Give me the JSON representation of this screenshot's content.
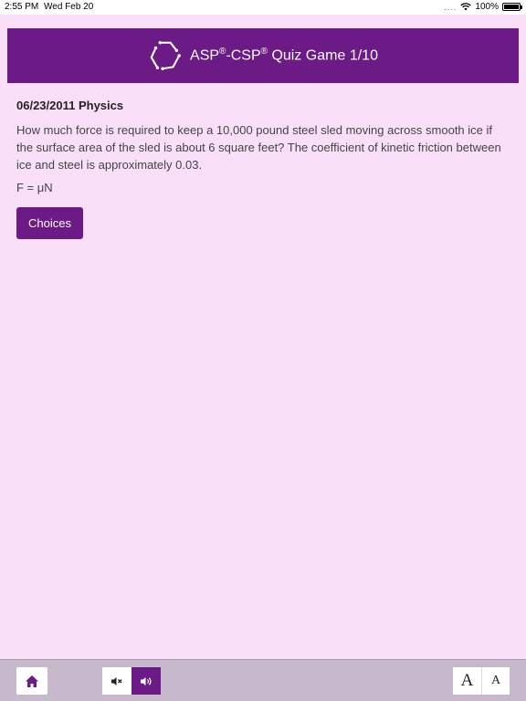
{
  "status_bar": {
    "time": "2:55 PM",
    "date": "Wed Feb 20",
    "battery": "100%"
  },
  "header": {
    "title_part1": "ASP",
    "reg1": "®",
    "title_part2": "-CSP",
    "reg2": "®",
    "title_part3": " Quiz Game 1/10"
  },
  "question": {
    "date_title": "06/23/2011 Physics",
    "text": "How much force is required to keep a 10,000 pound steel sled moving across smooth ice if the surface area of the sled is about 6 square feet? The coefficient of kinetic friction between ice and steel is approximately 0.03.",
    "formula": "F = μN",
    "choices_label": "Choices"
  },
  "toolbar": {
    "font_large_label": "A",
    "font_small_label": "A",
    "icons": [
      "home-icon",
      "mute-icon",
      "speaker-icon"
    ]
  },
  "colors": {
    "accent": "#6c1a85",
    "background": "#fadff9",
    "bottom_bar": "#c7b9cb"
  }
}
